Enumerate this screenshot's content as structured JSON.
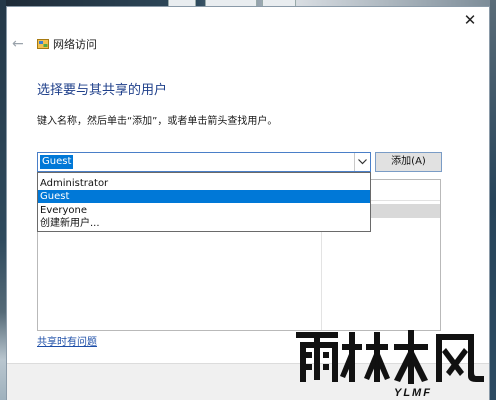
{
  "window": {
    "title": "网络访问",
    "close_glyph": "✕",
    "back_glyph": "←"
  },
  "main": {
    "heading": "选择要与其共享的用户",
    "instruction": "键入名称，然后单击“添加”，或者单击箭头查找用户。",
    "combo_value": "Guest",
    "add_button": "添加(A)",
    "dropdown_items": [
      "Administrator",
      "Guest",
      "Everyone",
      "创建新用户..."
    ],
    "dropdown_selected_index": 1,
    "help_link": "共享时有问题"
  },
  "watermark": {
    "logo_text": "雨林木风",
    "logo_sub": "YLMF"
  },
  "colors": {
    "accent": "#0078d7",
    "heading": "#1e3f8a",
    "link": "#1e4fa8"
  }
}
